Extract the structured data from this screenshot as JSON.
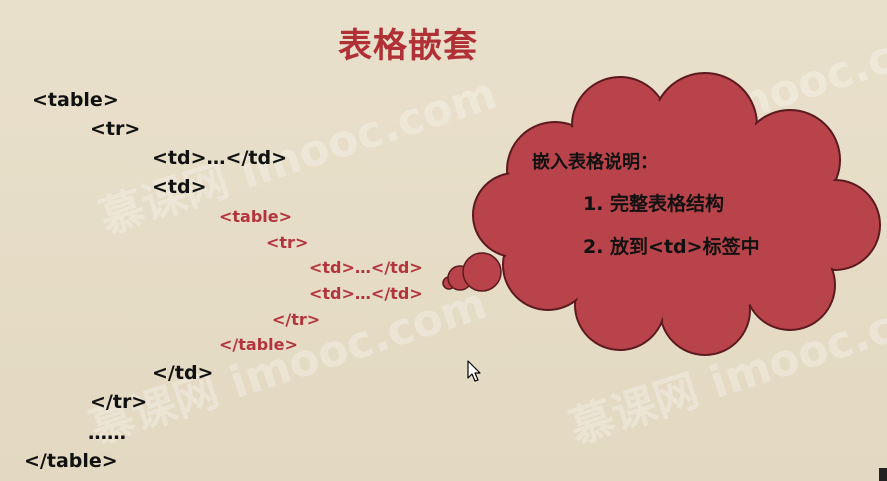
{
  "slide": {
    "title": "表格嵌套",
    "code_lines": [
      "<table>",
      "<tr>",
      "<td>…</td>",
      "<td>",
      "<table>",
      "<tr>",
      "<td>…</td>",
      "<td>…</td>",
      "</tr>",
      "</table>",
      "</td>",
      "</tr>",
      "……",
      "</table>"
    ],
    "cloud": {
      "heading": "嵌入表格说明：",
      "point_1": "1. 完整表格结构",
      "point_2": "2. 放到<td>标签中"
    },
    "watermark": "慕课网 imooc.com"
  },
  "colors": {
    "title": "#b03036",
    "nested_code": "#b3343c",
    "cloud_fill": "#b8434a",
    "background": "#e6dcc6"
  }
}
